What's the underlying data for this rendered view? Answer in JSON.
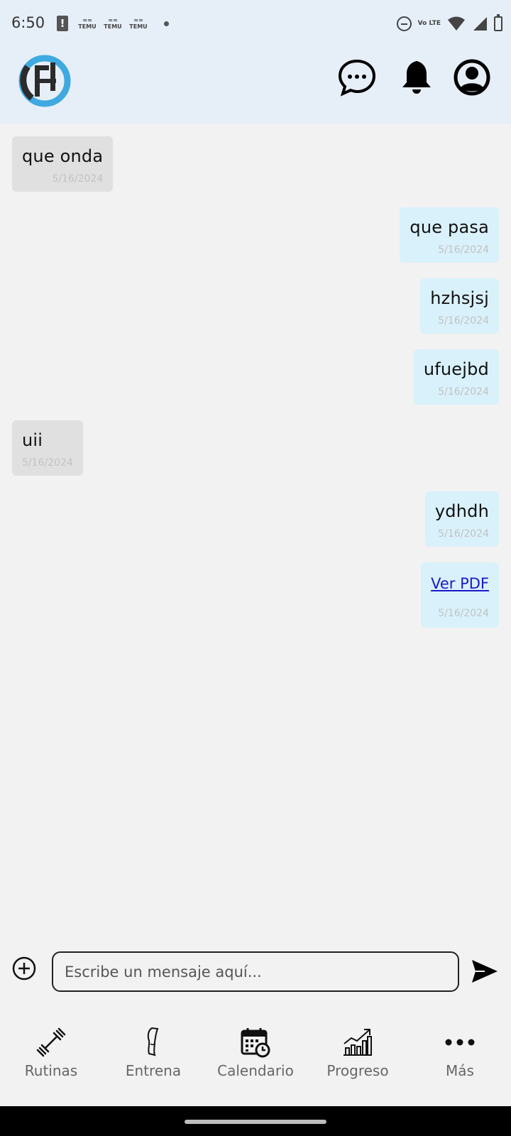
{
  "status_bar": {
    "time": "6:50",
    "notification_labels": [
      "TEMU",
      "TEMU",
      "TEMU"
    ],
    "network": "Vo LTE"
  },
  "header": {
    "logo_text": "FH",
    "icons": [
      "chat-icon",
      "bell-icon",
      "account-icon"
    ]
  },
  "messages": [
    {
      "direction": "incoming",
      "text": "que onda",
      "date": "5/16/2024"
    },
    {
      "direction": "outgoing",
      "text": "que pasa",
      "date": "5/16/2024"
    },
    {
      "direction": "outgoing",
      "text": "hzhsjsj",
      "date": "5/16/2024"
    },
    {
      "direction": "outgoing",
      "text": "ufuejbd",
      "date": "5/16/2024"
    },
    {
      "direction": "incoming",
      "text": "uii",
      "date": "5/16/2024"
    },
    {
      "direction": "outgoing",
      "text": "ydhdh",
      "date": "5/16/2024"
    },
    {
      "direction": "outgoing",
      "link_text": "Ver PDF",
      "date": "5/16/2024"
    }
  ],
  "composer": {
    "placeholder": "Escribe un mensaje aquí...",
    "value": ""
  },
  "bottom_nav": {
    "items": [
      {
        "label": "Rutinas",
        "icon": "dumbbell-icon"
      },
      {
        "label": "Entrena",
        "icon": "leg-icon"
      },
      {
        "label": "Calendario",
        "icon": "calendar-icon"
      },
      {
        "label": "Progreso",
        "icon": "progress-chart-icon"
      },
      {
        "label": "Más",
        "icon": "more-icon"
      }
    ]
  },
  "colors": {
    "header_bg": "#e6eff8",
    "incoming_bubble": "#e0e0e0",
    "outgoing_bubble": "#d9f1fb",
    "link": "#1a1ac7",
    "logo_blue": "#3fa9e0"
  }
}
